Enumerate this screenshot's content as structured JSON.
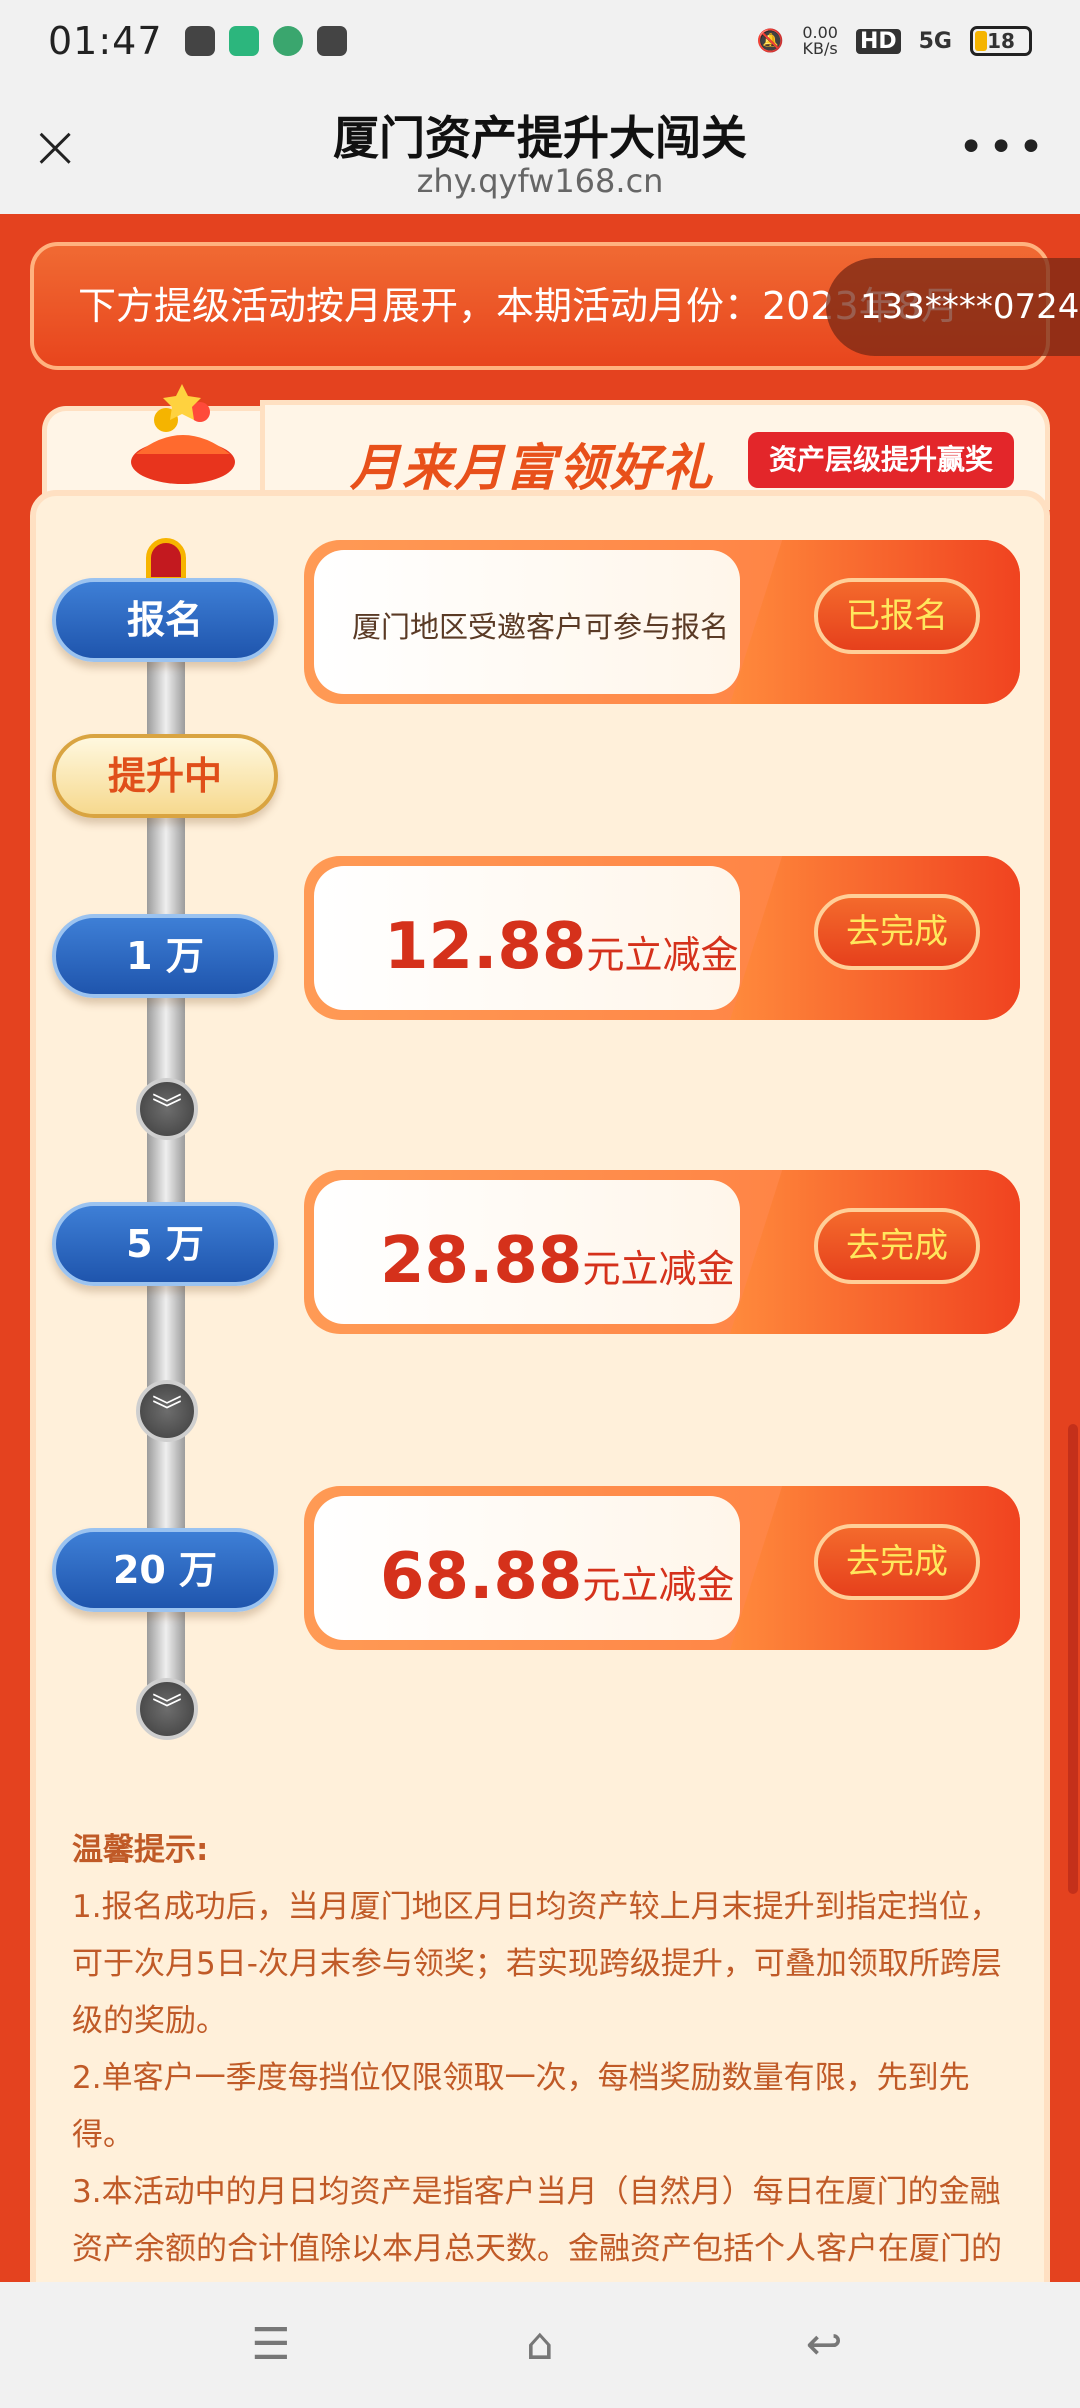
{
  "status_bar": {
    "time": "01:47",
    "net_speed": "0.00",
    "net_unit": "KB/s",
    "hd": "HD",
    "signal": "5G",
    "battery": "18"
  },
  "titlebar": {
    "title": "厦门资产提升大闯关",
    "url": "zhy.qyfw168.cn"
  },
  "banner": {
    "text": "下方提级活动按月展开，本期活动月份：2023年8月",
    "phone": "133****0724"
  },
  "card": {
    "title": "月来月富领好礼",
    "badge": "资产层级提升赢奖"
  },
  "steps": {
    "signup": "报名",
    "in_progress": "提升中",
    "level1": "1 万",
    "level2": "5 万",
    "level3": "20 万"
  },
  "tasks": {
    "signup_text": "厦门地区受邀客户可参与报名",
    "signup_btn": "已报名",
    "t1_amount": "12.88",
    "t1_unit": "元立减金",
    "t1_btn": "去完成",
    "t2_amount": "28.88",
    "t2_unit": "元立减金",
    "t2_btn": "去完成",
    "t3_amount": "68.88",
    "t3_unit": "元立减金",
    "t3_btn": "去完成"
  },
  "tips": {
    "heading": "温馨提示:",
    "p1": "1.报名成功后，当月厦门地区月日均资产较上月末提升到指定挡位，可于次月5日-次月末参与领奖；若实现跨级提升，可叠加领取所跨层级的奖励。",
    "p2": "2.单客户一季度每挡位仅限领取一次，每档奖励数量有限，先到先得。",
    "p3": "3.本活动中的月日均资产是指客户当月（自然月）每日在厦门的金融资产余额的合计值除以本月总天数。金融资产包括个人客户在厦门的"
  }
}
